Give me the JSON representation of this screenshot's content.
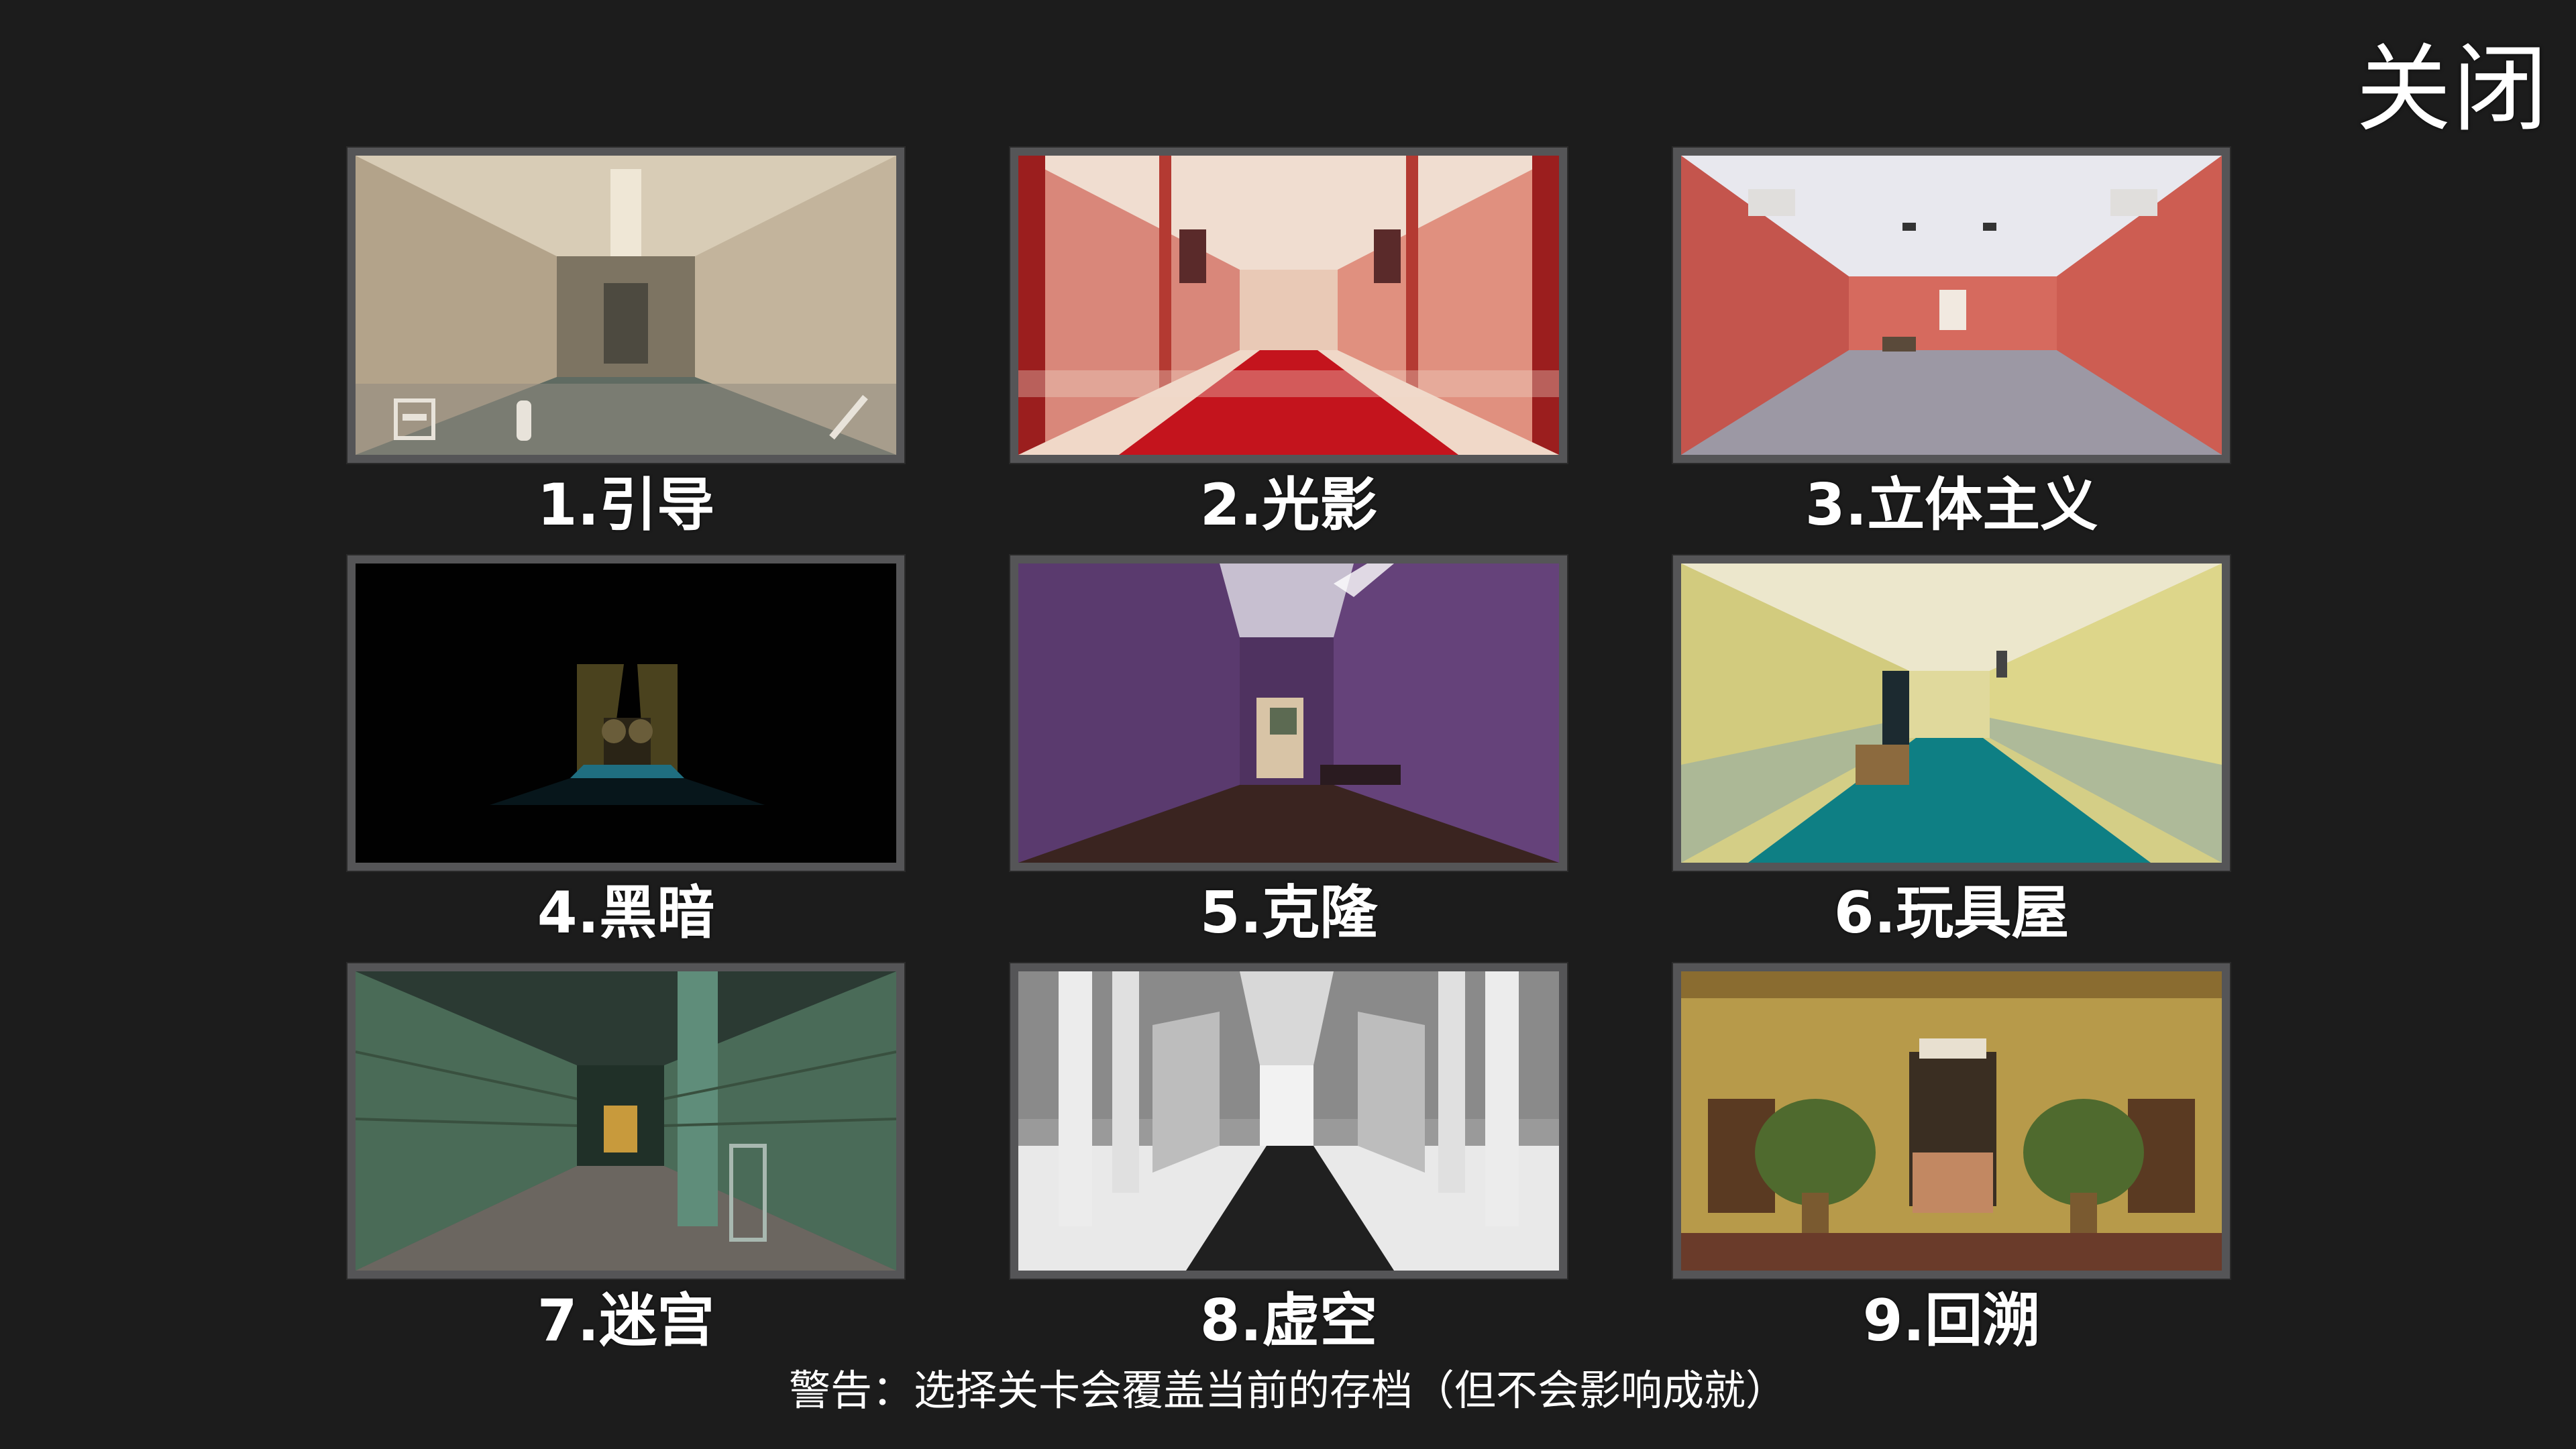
{
  "header": {
    "close_label": "关闭"
  },
  "levels": [
    {
      "label": "1.引导",
      "scene": "guide-corridor-icon"
    },
    {
      "label": "2.光影",
      "scene": "red-carpet-corridor-icon"
    },
    {
      "label": "3.立体主义",
      "scene": "red-wall-hallway-icon"
    },
    {
      "label": "4.黑暗",
      "scene": "dark-corridor-icon"
    },
    {
      "label": "5.克隆",
      "scene": "purple-room-icon"
    },
    {
      "label": "6.玩具屋",
      "scene": "yellow-hallway-icon"
    },
    {
      "label": "7.迷宫",
      "scene": "green-tile-corridor-icon"
    },
    {
      "label": "8.虚空",
      "scene": "white-void-corridor-icon"
    },
    {
      "label": "9.回溯",
      "scene": "lobby-plants-icon"
    }
  ],
  "footer": {
    "warning": "警告：选择关卡会覆盖当前的存档（但不会影响成就）"
  },
  "colors": {
    "background": "#1c1c1c",
    "frame": "#555557",
    "text": "#ffffff"
  }
}
